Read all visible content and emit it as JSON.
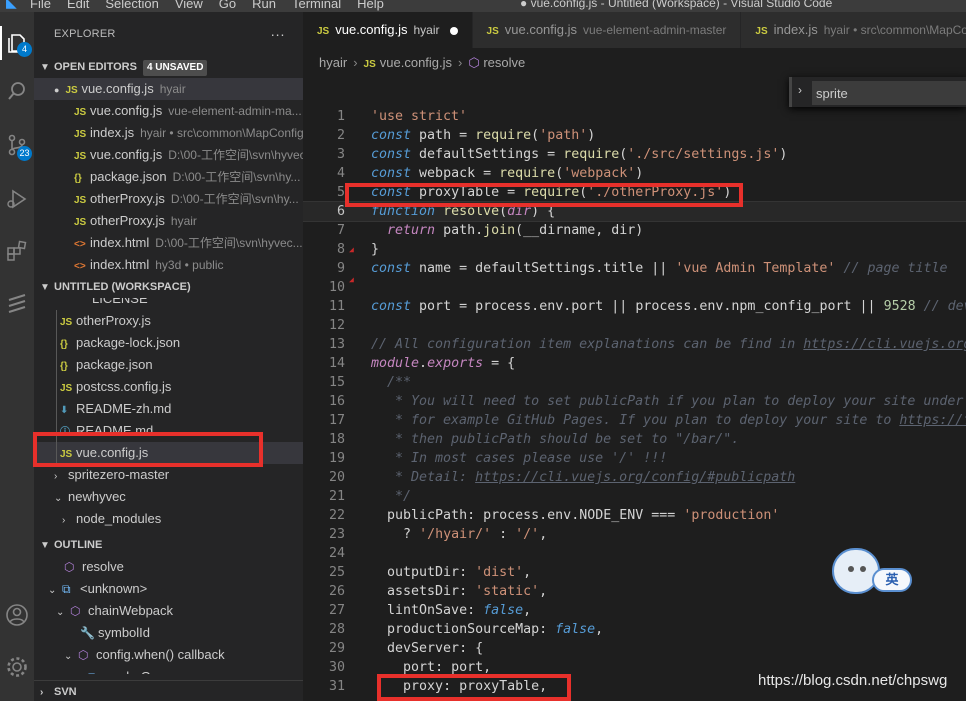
{
  "window": {
    "title": "● vue.config.js - Untitled (Workspace) - Visual Studio Code",
    "menu": [
      "File",
      "Edit",
      "Selection",
      "View",
      "Go",
      "Run",
      "Terminal",
      "Help"
    ]
  },
  "activity": {
    "explorer_badge": "4",
    "scm_badge": "23"
  },
  "sidebar": {
    "title": "EXPLORER",
    "more": "···",
    "open_editors": {
      "label": "OPEN EDITORS",
      "badge": "4 UNSAVED",
      "items": [
        {
          "icon": "JS",
          "name": "vue.config.js",
          "desc": "hyair"
        },
        {
          "icon": "JS",
          "name": "vue.config.js",
          "desc": "vue-element-admin-ma..."
        },
        {
          "icon": "JS",
          "name": "index.js",
          "desc": "hyair • src\\common\\MapConfig"
        },
        {
          "icon": "JS",
          "name": "vue.config.js",
          "desc": "D:\\00-工作空间\\svn\\hyvec"
        },
        {
          "icon": "{}",
          "name": "package.json",
          "desc": "D:\\00-工作空间\\svn\\hy..."
        },
        {
          "icon": "JS",
          "name": "otherProxy.js",
          "desc": "D:\\00-工作空间\\svn\\hy..."
        },
        {
          "icon": "JS",
          "name": "otherProxy.js",
          "desc": "hyair"
        },
        {
          "icon": "<>",
          "name": "index.html",
          "desc": "D:\\00-工作空间\\svn\\hyvec..."
        },
        {
          "icon": "<>",
          "name": "index.html",
          "desc": "hy3d • public"
        }
      ]
    },
    "workspace": {
      "label": "UNTITLED (WORKSPACE)",
      "items": [
        {
          "icon": "",
          "name": "LICENSE"
        },
        {
          "icon": "JS",
          "name": "otherProxy.js"
        },
        {
          "icon": "{}",
          "name": "package-lock.json"
        },
        {
          "icon": "{}",
          "name": "package.json"
        },
        {
          "icon": "JS",
          "name": "postcss.config.js"
        },
        {
          "icon": "⬇",
          "name": "README-zh.md"
        },
        {
          "icon": "ⓘ",
          "name": "README.md"
        },
        {
          "icon": "JS",
          "name": "vue.config.js"
        },
        {
          "icon": ">",
          "name": "spritezero-master"
        },
        {
          "icon": "v",
          "name": "newhyvec"
        },
        {
          "icon": ">",
          "name": "node_modules"
        }
      ]
    },
    "outline": {
      "label": "OUTLINE",
      "items": [
        {
          "name": "resolve"
        },
        {
          "name": "<unknown>"
        },
        {
          "name": "chainWebpack"
        },
        {
          "name": "symbolId"
        },
        {
          "name": "config.when() callback"
        },
        {
          "name": "cacheGroups"
        }
      ]
    },
    "svn": {
      "label": "SVN"
    }
  },
  "tabs": [
    {
      "icon": "JS",
      "label": "vue.config.js",
      "desc": "hyair",
      "active": true,
      "dirty": true
    },
    {
      "icon": "JS",
      "label": "vue.config.js",
      "desc": "vue-element-admin-master",
      "active": false
    },
    {
      "icon": "JS",
      "label": "index.js",
      "desc": "hyair • src\\common\\MapCo",
      "active": false
    }
  ],
  "breadcrumb": {
    "root": "hyair",
    "file": "vue.config.js",
    "symbol": "resolve"
  },
  "find": {
    "value": "sprite"
  },
  "code": {
    "lines": [
      {
        "n": "1"
      },
      {
        "n": "2"
      },
      {
        "n": "3"
      },
      {
        "n": "4"
      },
      {
        "n": "5"
      },
      {
        "n": "6"
      },
      {
        "n": "7"
      },
      {
        "n": "8"
      },
      {
        "n": "9"
      },
      {
        "n": "10"
      },
      {
        "n": "11"
      },
      {
        "n": "12"
      },
      {
        "n": "13"
      },
      {
        "n": "14"
      },
      {
        "n": "15"
      },
      {
        "n": "16"
      },
      {
        "n": "17"
      },
      {
        "n": "18"
      },
      {
        "n": "19"
      },
      {
        "n": "20"
      },
      {
        "n": "21"
      },
      {
        "n": "22"
      },
      {
        "n": "23"
      },
      {
        "n": "24"
      },
      {
        "n": "25"
      },
      {
        "n": "26"
      },
      {
        "n": "27"
      },
      {
        "n": "28"
      },
      {
        "n": "29"
      },
      {
        "n": "30"
      },
      {
        "n": "31"
      }
    ]
  },
  "ime": {
    "label": "英"
  },
  "watermark": "https://blog.csdn.net/chpswg"
}
